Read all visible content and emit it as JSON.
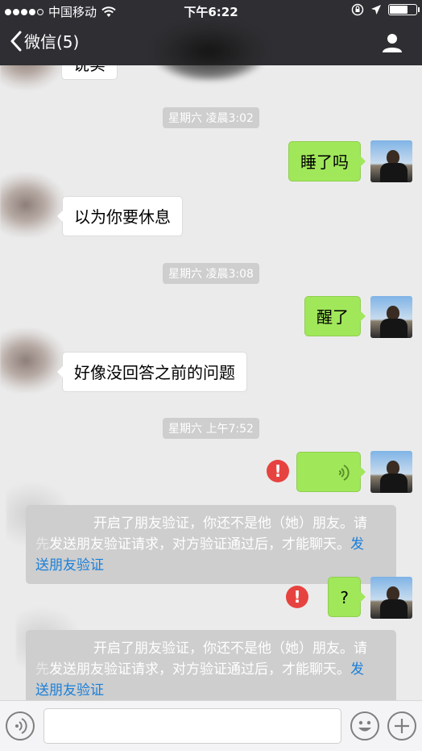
{
  "status_bar": {
    "carrier": "中国移动",
    "time": "下午6:22",
    "signal_dots": 5
  },
  "nav": {
    "back_label": "微信(5)"
  },
  "messages": [
    {
      "type": "other_partial",
      "text": "说实"
    },
    {
      "type": "timestamp",
      "text": "星期六 凌晨3:02"
    },
    {
      "type": "self",
      "text": "睡了吗"
    },
    {
      "type": "other",
      "text": "以为你要休息"
    },
    {
      "type": "timestamp",
      "text": "星期六 凌晨3:08"
    },
    {
      "type": "self",
      "text": "醒了"
    },
    {
      "type": "other",
      "text": "好像没回答之前的问题"
    },
    {
      "type": "timestamp",
      "text": "星期六 上午7:52"
    },
    {
      "type": "self_voice_failed",
      "fail_mark": "!"
    },
    {
      "type": "system",
      "text": "开启了朋友验证，你还不是他（她）朋友。请先发送朋友验证请求，对方验证通过后，才能聊天。",
      "link": "发送朋友验证"
    },
    {
      "type": "self_failed",
      "text": "?",
      "fail_mark": "!"
    },
    {
      "type": "system",
      "text": "开启了朋友验证，你还不是他（她）朋友。请先发送朋友验证请求，对方验证通过后，才能聊天。",
      "link": "发送朋友验证"
    }
  ],
  "system_notes": [
    {
      "line1": "开启了朋友验证，你还不是他（她）朋友。请",
      "line2": "发送朋友验证请求，对方验证通过后，才能聊天。",
      "link_a": "发",
      "link_b": "送朋友验证"
    },
    {
      "line1": "开启了朋友验证，你还不是他（她）朋友。请",
      "line2": "发送朋友验证请求，对方验证通过后，才能聊天。",
      "link_a": "发",
      "link_b": "送朋友验证"
    }
  ],
  "colors": {
    "topbar": "#2e2e33",
    "background": "#ebebeb",
    "self_bubble": "#a0e75a",
    "fail_red": "#e64340",
    "link_blue": "#1a7fd9"
  },
  "icons": {
    "back": "chevron-left-icon",
    "profile": "person-icon",
    "voice_mode": "voice-icon",
    "emoji": "smiley-icon",
    "more": "plus-icon"
  }
}
